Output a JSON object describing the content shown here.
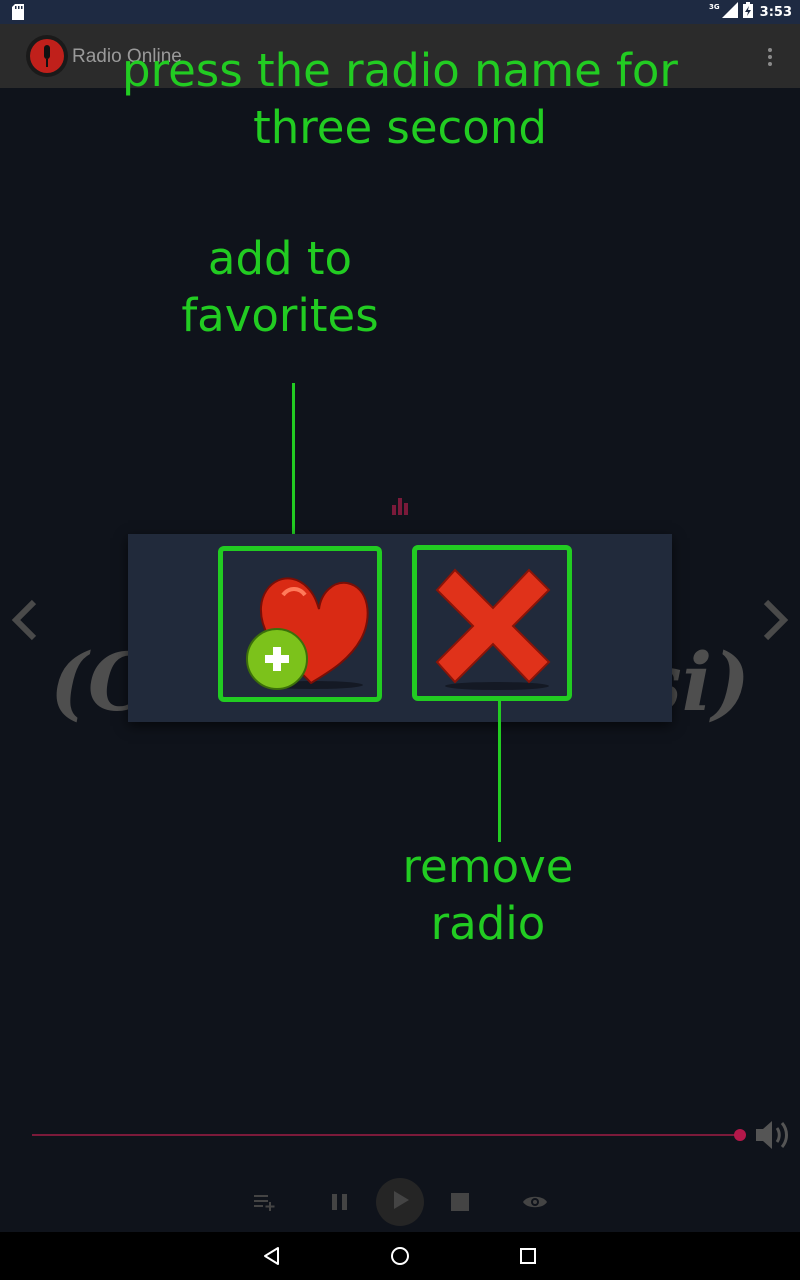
{
  "status_bar": {
    "network": "3G",
    "time": "3:53"
  },
  "app_bar": {
    "title": "Radio Online"
  },
  "annotations": {
    "top_line1": "press the radio name for",
    "top_line2": "three second",
    "favorites_line1": "add to",
    "favorites_line2": "favorites",
    "remove_line1": "remove",
    "remove_line2": "radio"
  },
  "station": {
    "name_left_fragment": "(C",
    "name_mid_fragment": ")",
    "name_right_fragment": "si)"
  },
  "dialog": {
    "options": [
      {
        "action": "add-to-favorites",
        "icon": "heart-plus-icon"
      },
      {
        "action": "remove-radio",
        "icon": "red-x-icon"
      }
    ]
  },
  "player": {
    "volume_level": 0.99,
    "controls": [
      "add-to-playlist-icon",
      "pause-icon",
      "play-icon",
      "stop-icon",
      "eye-icon"
    ]
  },
  "colors": {
    "annotation_green": "#22cc22",
    "accent": "#b4184a",
    "background": "#0f131b",
    "dialog_bg": "#212a3b",
    "status_bar": "#1e2a42"
  }
}
